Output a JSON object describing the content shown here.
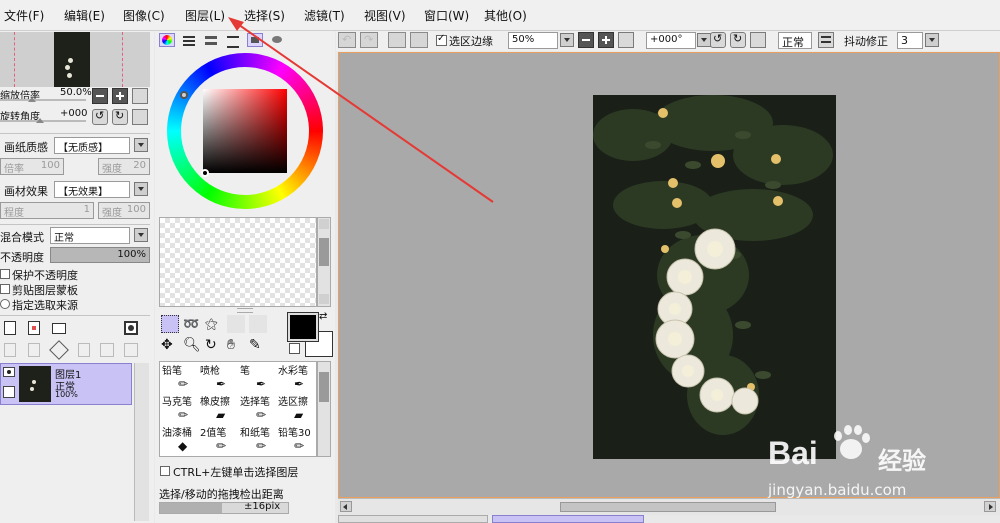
{
  "menu": [
    "文件(F)",
    "编辑(E)",
    "图像(C)",
    "图层(L)",
    "选择(S)",
    "滤镜(T)",
    "视图(V)",
    "窗口(W)",
    "其他(O)"
  ],
  "navigator": {
    "zoom_label": "缩放倍率",
    "zoom_value": "50.0%",
    "rotate_label": "旋转角度",
    "rotate_value": "+000"
  },
  "paper": {
    "texture_label": "画纸质感",
    "texture_value": "【无质感】",
    "ratio_label": "倍率",
    "ratio_value": "100",
    "strength_label": "强度",
    "strength_value": "20"
  },
  "effect": {
    "label": "画材效果",
    "value": "【无效果】",
    "degree_label": "程度",
    "degree_value": "1",
    "strength_label": "强度",
    "strength_value": "100"
  },
  "blend": {
    "label": "混合模式",
    "value": "正常"
  },
  "opacity": {
    "label": "不透明度",
    "value": "100%"
  },
  "checks": [
    "保护不透明度",
    "剪贴图层蒙板",
    "指定选取来源"
  ],
  "layer": {
    "name": "图层1",
    "mode": "正常",
    "opacity": "100%"
  },
  "toolbar": {
    "selection_edge": "选区边缘",
    "zoom": "50%",
    "angle": "+000°",
    "mode": "正常",
    "stabilizer_label": "抖动修正",
    "stabilizer_value": "3"
  },
  "brushes": [
    [
      "铅笔",
      "喷枪",
      "笔",
      "水彩笔"
    ],
    [
      "马克笔",
      "橡皮擦",
      "选择笔",
      "选区擦"
    ],
    [
      "油漆桶",
      "2值笔",
      "和纸笔",
      "铅笔30"
    ]
  ],
  "ctrl_option": "CTRL+左键单击选择图层",
  "drag_label": "选择/移动的拖拽检出距离",
  "drag_value": "±16pix",
  "watermark": {
    "brand_a": "Bai",
    "brand_b": "经验",
    "url": "jingyan.baidu.com"
  },
  "colors": {
    "canvas_bg": "#a9a9a9",
    "accent": "#c9c2f5",
    "arrow": "#e53935",
    "photo_bg": "#1d2119"
  }
}
